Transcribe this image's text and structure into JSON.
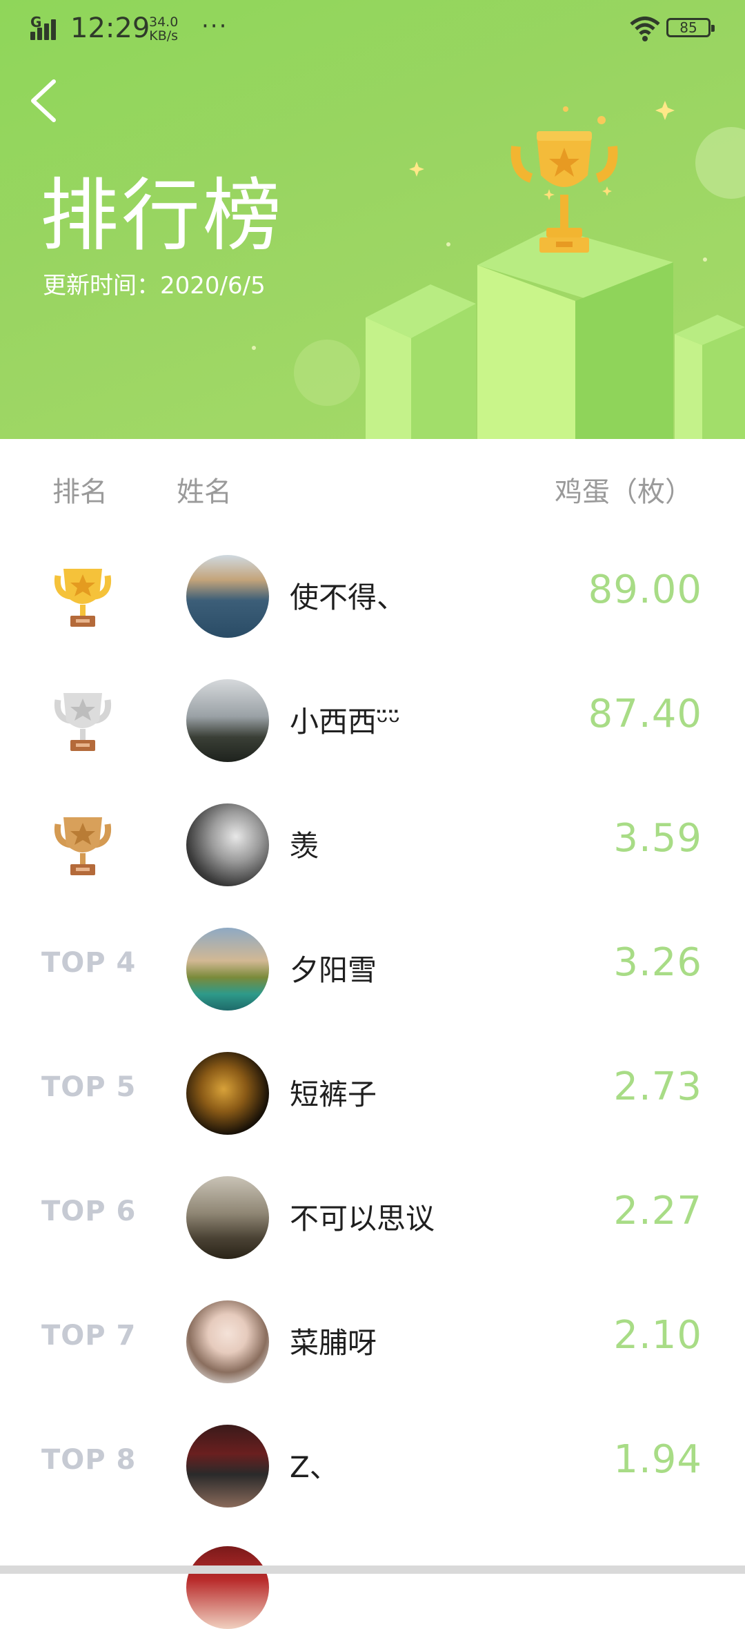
{
  "status_bar": {
    "network_type": "G",
    "time": "12:29",
    "net_speed_value": "34.0",
    "net_speed_unit": "KB/s",
    "more": "···",
    "battery": "85"
  },
  "header": {
    "title": "排行榜",
    "update_time": "更新时间：2020/6/5"
  },
  "table": {
    "columns": {
      "rank": "排名",
      "name": "姓名",
      "score": "鸡蛋（枚）"
    },
    "rows": [
      {
        "rank_label": "",
        "rank_icon": "gold-trophy-icon",
        "name": "使不得、",
        "score": "89.00"
      },
      {
        "rank_label": "",
        "rank_icon": "silver-trophy-icon",
        "name": "小西西ᵕ̈ᵕ̈",
        "score": "87.40"
      },
      {
        "rank_label": "",
        "rank_icon": "bronze-trophy-icon",
        "name": "羡",
        "score": "3.59"
      },
      {
        "rank_label": "TOP 4",
        "name": "夕阳雪",
        "score": "3.26"
      },
      {
        "rank_label": "TOP 5",
        "name": "短裤子",
        "score": "2.73"
      },
      {
        "rank_label": "TOP 6",
        "name": "不可以思议",
        "score": "2.27"
      },
      {
        "rank_label": "TOP 7",
        "name": "菜脯呀",
        "score": "2.10"
      },
      {
        "rank_label": "TOP 8",
        "name": "Z、",
        "score": "1.94"
      }
    ]
  },
  "colors": {
    "hero_green": "#9ad562",
    "score_green": "#a8dc86",
    "gold": "#f5c23a",
    "silver": "#d5d5d5",
    "bronze": "#d49a52"
  }
}
